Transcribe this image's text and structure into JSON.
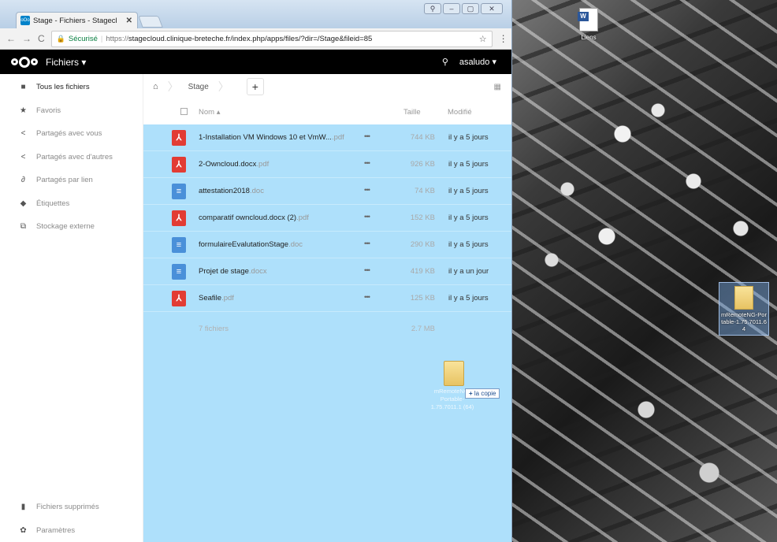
{
  "browser": {
    "tab_title": "Stage - Fichiers - Stagecl",
    "tab_close": "✕",
    "window_controls": [
      "⚲",
      "–",
      "▢",
      "✕"
    ],
    "secure_label": "Sécurisé",
    "url_scheme": "https://",
    "url_rest": "stagecloud.clinique-breteche.fr/index.php/apps/files/?dir=/Stage&fileid=85",
    "favicon_text": "oOo"
  },
  "header": {
    "app_name": "Fichiers ▾",
    "user": "asaludo ▾"
  },
  "sidebar": {
    "items": [
      {
        "label": "Tous les fichiers",
        "icon": "folder-icon",
        "glyph": "■"
      },
      {
        "label": "Favoris",
        "icon": "star-icon",
        "glyph": "★"
      },
      {
        "label": "Partagés avec vous",
        "icon": "share-icon",
        "glyph": "<"
      },
      {
        "label": "Partagés avec d'autres",
        "icon": "share-icon",
        "glyph": "<"
      },
      {
        "label": "Partagés par lien",
        "icon": "link-icon",
        "glyph": "∂"
      },
      {
        "label": "Étiquettes",
        "icon": "tag-icon",
        "glyph": "◆"
      },
      {
        "label": "Stockage externe",
        "icon": "external-icon",
        "glyph": "⧉"
      }
    ],
    "bottom": [
      {
        "label": "Fichiers supprimés",
        "icon": "trash-icon",
        "glyph": "▮"
      },
      {
        "label": "Paramètres",
        "icon": "gear-icon",
        "glyph": "✿"
      }
    ]
  },
  "controls": {
    "breadcrumb": "Stage",
    "new_button": "+"
  },
  "table": {
    "col_name": "Nom ▴",
    "col_size": "Taille",
    "col_modified": "Modifié",
    "rows": [
      {
        "name": "1-Installation VM Windows 10 et VmW...",
        "ext": ".pdf",
        "type": "pdf",
        "size": "744 KB",
        "modified": "il y a 5 jours"
      },
      {
        "name": "2-Owncloud.docx",
        "ext": ".pdf",
        "type": "pdf",
        "size": "926 KB",
        "modified": "il y a 5 jours"
      },
      {
        "name": "attestation2018",
        "ext": ".doc",
        "type": "doc",
        "size": "74 KB",
        "modified": "il y a 5 jours"
      },
      {
        "name": "comparatif owncloud.docx (2)",
        "ext": ".pdf",
        "type": "pdf",
        "size": "152 KB",
        "modified": "il y a 5 jours"
      },
      {
        "name": "formulaireEvalutationStage",
        "ext": ".doc",
        "type": "doc",
        "size": "290 KB",
        "modified": "il y a 5 jours"
      },
      {
        "name": "Projet de stage",
        "ext": ".docx",
        "type": "doc",
        "size": "419 KB",
        "modified": "il y a un jour"
      },
      {
        "name": "Seafile",
        "ext": ".pdf",
        "type": "pdf",
        "size": "125 KB",
        "modified": "il y a 5 jours"
      }
    ],
    "summary_count": "7 fichiers",
    "summary_size": "2.7 MB",
    "actions_glyph": "•••"
  },
  "drag": {
    "tooltip_plus": "+",
    "tooltip_text": "la copie",
    "label": "mRemoteNG-Portable-1.75.7011.1 (64)"
  },
  "desktop": {
    "word_icon_label": "Liens",
    "folder_icon_label": "mRemoteNG-Portable-1.75.7011.64"
  }
}
